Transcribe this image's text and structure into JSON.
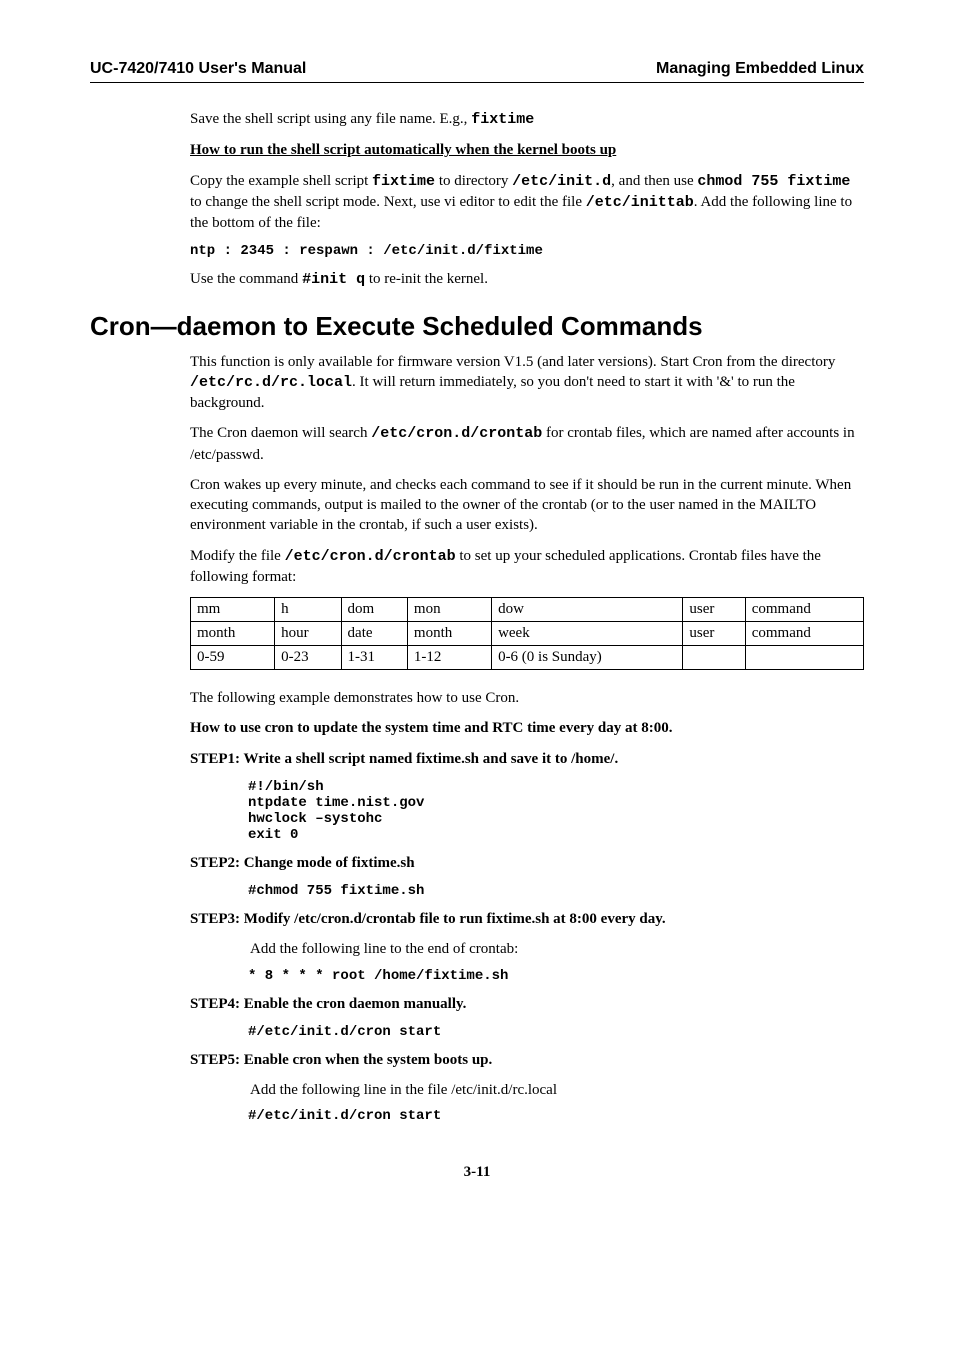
{
  "header": {
    "left": "UC-7420/7410 User's Manual",
    "right": "Managing Embedded Linux"
  },
  "intro": {
    "save_line_pre": "Save the shell script using any file name. E.g., ",
    "save_line_code": "fixtime",
    "howto_heading": "How to run the shell script automatically when the kernel boots up",
    "copy_p1a": "Copy the example shell script ",
    "copy_p1b": "fixtime",
    "copy_p1c": " to directory ",
    "copy_p1d": "/etc/init.d",
    "copy_p1e": ", and then use ",
    "copy_p1f": "chmod 755 fixtime",
    "copy_p1g": " to change the shell script mode. Next, use vi editor to edit the file ",
    "copy_p1h": "/etc/inittab",
    "copy_p1i": ". Add the following line to the bottom of the file:",
    "ntp_line": "ntp : 2345 : respawn : /etc/init.d/fixtime",
    "usecmd_a": "Use the command ",
    "usecmd_b": "#init q",
    "usecmd_c": " to re-init the kernel."
  },
  "section_title": "Cron—daemon to Execute Scheduled Commands",
  "cron": {
    "p1a": "This function is only available for firmware version V1.5 (and later versions). Start Cron from the directory ",
    "p1b": "/etc/rc.d/rc.local",
    "p1c": ". It will return immediately, so you don't need to start it with '&' to run the background.",
    "p2a": "The Cron daemon will search ",
    "p2b": "/etc/cron.d/crontab",
    "p2c": " for crontab files, which are named after accounts in /etc/passwd.",
    "p3": "Cron wakes up every minute, and checks each command to see if it should be run in the current minute. When executing commands, output is mailed to the owner of the crontab (or to the user named in the MAILTO environment variable in the crontab, if such a user exists).",
    "p4a": "Modify the file ",
    "p4b": "/etc/cron.d/crontab",
    "p4c": " to set up your scheduled applications. Crontab files have the following format:"
  },
  "table": {
    "r1": [
      "mm",
      "h",
      "dom",
      "mon",
      "dow",
      "user",
      "command"
    ],
    "r2": [
      "month",
      "hour",
      "date",
      "month",
      "week",
      "user",
      "command"
    ],
    "r3": [
      "0-59",
      "0-23",
      "1-31",
      "1-12",
      "0-6 (0 is Sunday)",
      "",
      ""
    ]
  },
  "after_table": {
    "demo": "The following example demonstrates how to use Cron.",
    "howto": "How to use cron to update the system time and RTC time every day at 8:00."
  },
  "steps": {
    "s1_title": "STEP1: Write a shell script named fixtime.sh and save it to /home/.",
    "s1_code": "#!/bin/sh\nntpdate time.nist.gov\nhwclock –systohc\nexit 0",
    "s2_title": "STEP2: Change mode of fixtime.sh",
    "s2_code": "#chmod 755 fixtime.sh",
    "s3_title": "STEP3: Modify /etc/cron.d/crontab file to run fixtime.sh at 8:00 every day.",
    "s3_text": "Add the following line to the end of crontab:",
    "s3_code": "* 8 * * * root /home/fixtime.sh",
    "s4_title": "STEP4: Enable the cron daemon manually.",
    "s4_code": "#/etc/init.d/cron start",
    "s5_title": "STEP5: Enable cron when the system boots up.",
    "s5_text": "Add the following line in the file /etc/init.d/rc.local",
    "s5_code": "#/etc/init.d/cron start"
  },
  "page_number": "3-11"
}
